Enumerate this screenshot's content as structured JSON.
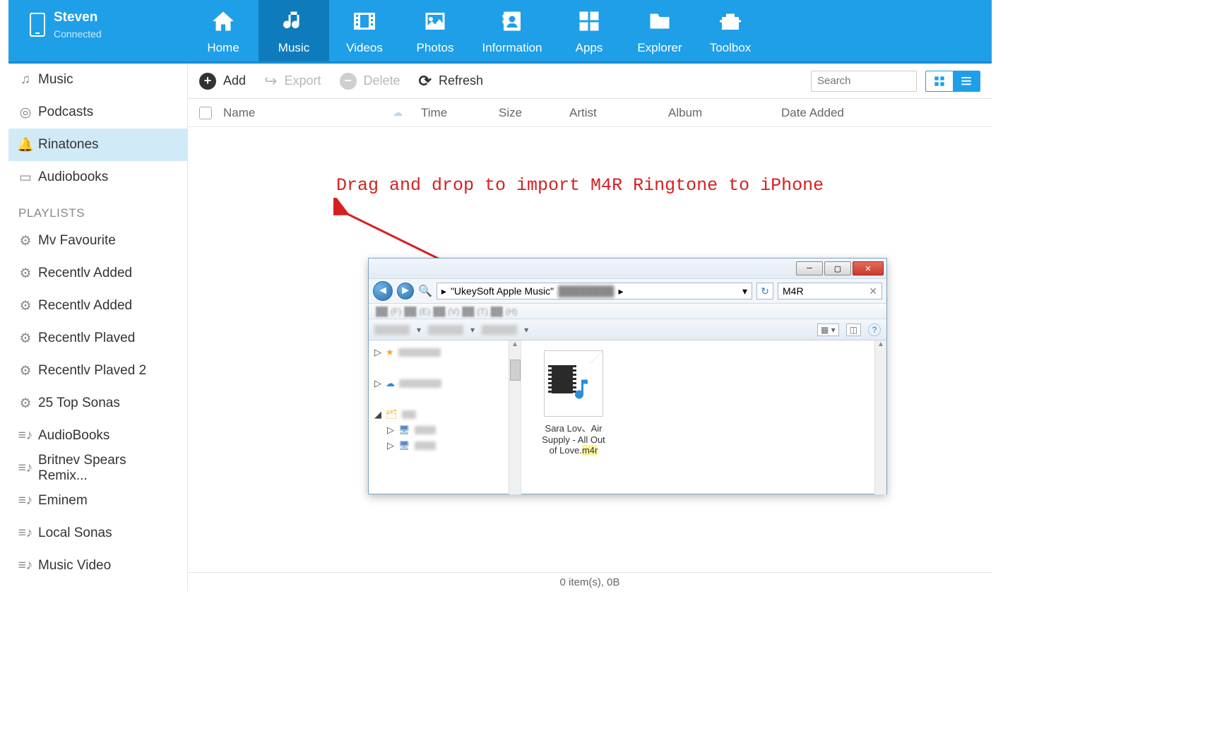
{
  "device": {
    "name": "Steven",
    "status": "Connected"
  },
  "nav": {
    "home": "Home",
    "music": "Music",
    "videos": "Videos",
    "photos": "Photos",
    "information": "Information",
    "apps": "Apps",
    "explorer": "Explorer",
    "toolbox": "Toolbox"
  },
  "toolbar": {
    "add": "Add",
    "export": "Export",
    "delete": "Delete",
    "refresh": "Refresh",
    "search_placeholder": "Search"
  },
  "columns": {
    "name": "Name",
    "time": "Time",
    "size": "Size",
    "artist": "Artist",
    "album": "Album",
    "date_added": "Date Added"
  },
  "sidebar": {
    "music": "Music",
    "podcasts": "Podcasts",
    "ringtones": "Rinatones",
    "audiobooks": "Audiobooks",
    "playlists_header": "PLAYLISTS",
    "playlists": [
      "Mv Favourite",
      "Recentlv Added",
      "Recentlv Added",
      "Recentlv Plaved",
      "Recentlv Plaved 2",
      "25 Top Sonas",
      "AudioBooks",
      "Britnev Spears Remix...",
      "Eminem",
      "Local Sonas",
      "Music Video"
    ]
  },
  "overlay": {
    "text": "Drag and drop to import M4R Ringtone to iPhone"
  },
  "status": {
    "text": "0 item(s), 0B"
  },
  "explorer": {
    "path_label": "\"UkeySoft Apple Music\"",
    "search_value": "M4R",
    "menu": {
      "f": "(F)",
      "e": "(E)",
      "v": "(V)",
      "t": "(T)",
      "h": "(H)"
    },
    "file": {
      "line1": "Sara Lov、Air",
      "line2": "Supply - All Out",
      "line3_a": "of Love.",
      "line3_ext": "m4r"
    }
  }
}
